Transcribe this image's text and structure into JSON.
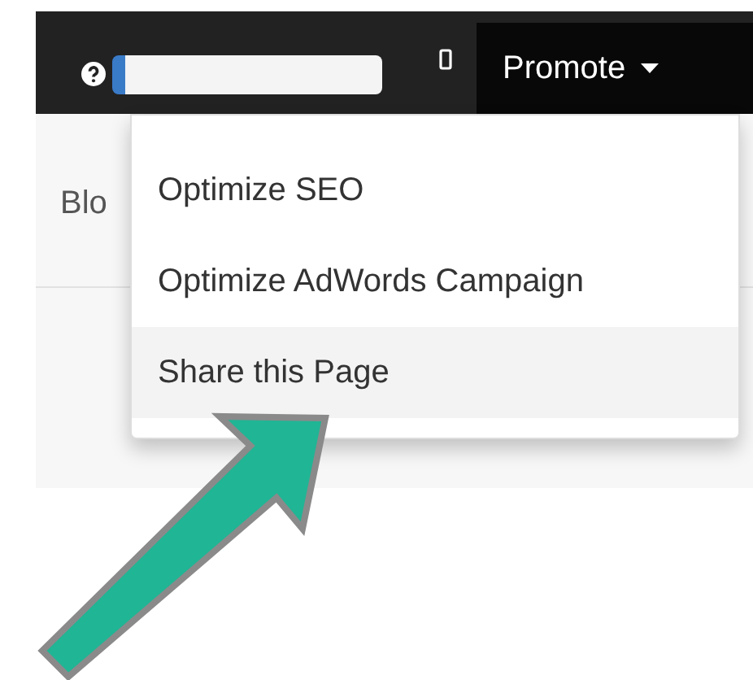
{
  "navbar": {
    "menu": {
      "label": "Promote",
      "expanded": true
    }
  },
  "tabs": [
    {
      "label": "Blo"
    }
  ],
  "dropdown": {
    "items": [
      {
        "label": "Optimize SEO",
        "selected": false
      },
      {
        "label": "Optimize AdWords Campaign",
        "selected": false
      },
      {
        "label": "Share this Page",
        "selected": true
      }
    ]
  }
}
